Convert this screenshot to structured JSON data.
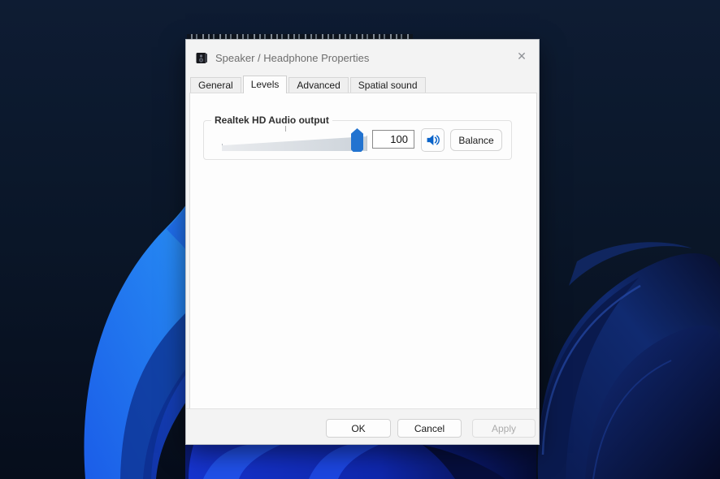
{
  "window": {
    "title": "Speaker / Headphone Properties",
    "close_glyph": "✕",
    "title_icon": "speaker-icon"
  },
  "tabs": [
    {
      "label": "General",
      "active": false
    },
    {
      "label": "Levels",
      "active": true
    },
    {
      "label": "Advanced",
      "active": false
    },
    {
      "label": "Spatial sound",
      "active": false
    }
  ],
  "levels": {
    "group_label": "Realtek HD Audio output",
    "volume": "100",
    "slider": {
      "value": 100,
      "thumb_percent": 93,
      "center_tick": true
    },
    "mute_icon": "speaker-volume-icon",
    "balance_label": "Balance"
  },
  "footer": {
    "ok_label": "OK",
    "cancel_label": "Cancel",
    "apply_label": "Apply",
    "apply_disabled": true
  },
  "colors": {
    "slider_thumb": "#2273d0",
    "speaker_glyph": "#0a63c9",
    "dialog_bg": "#f3f3f3",
    "page_bg": "#fdfdfd",
    "wallpaper_navy": "#0a1626",
    "wallpaper_bright_blue": "#1f6ef0",
    "wallpaper_dark_blue": "#0b1d5a"
  }
}
